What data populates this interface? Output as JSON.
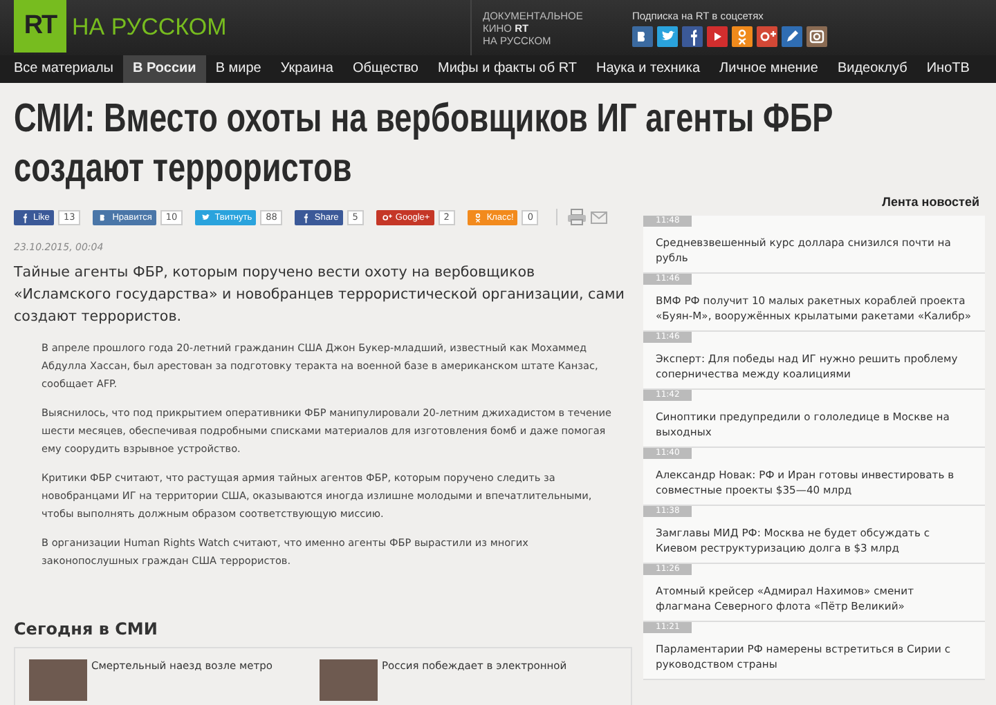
{
  "header": {
    "logo": "RT",
    "logo_caption": "НА РУССКОМ",
    "doc_lines": [
      "ДОКУМЕНТАЛЬНОЕ",
      "КИНО",
      "RT",
      "НА РУССКОМ"
    ],
    "social_title": "Подписка на RT в соцсетях",
    "social_icons": [
      {
        "kind": "vk",
        "color": "#3b6aa0"
      },
      {
        "kind": "twitter",
        "color": "#2aa3dd"
      },
      {
        "kind": "facebook",
        "color": "#3b5998"
      },
      {
        "kind": "youtube",
        "color": "#d22e2e"
      },
      {
        "kind": "odnoklassniki",
        "color": "#f08a1c"
      },
      {
        "kind": "googleplus",
        "color": "#d34836"
      },
      {
        "kind": "livejournal",
        "color": "#2f6db3"
      },
      {
        "kind": "instagram",
        "color": "#8a6b53"
      }
    ]
  },
  "nav": [
    {
      "label": "Все материалы",
      "selected": false
    },
    {
      "label": "В России",
      "selected": true
    },
    {
      "label": "В мире",
      "selected": false
    },
    {
      "label": "Украина",
      "selected": false
    },
    {
      "label": "Общество",
      "selected": false
    },
    {
      "label": "Мифы и факты об RT",
      "selected": false
    },
    {
      "label": "Наука и техника",
      "selected": false
    },
    {
      "label": "Личное мнение",
      "selected": false
    },
    {
      "label": "Видеоклуб",
      "selected": false
    },
    {
      "label": "ИноТВ",
      "selected": false
    }
  ],
  "article": {
    "title": "СМИ: Вместо охоты на вербовщиков ИГ агенты ФБР создают террористов",
    "share": [
      {
        "kind": "facebook",
        "label": "Like",
        "count": "13",
        "color": "#3b5998"
      },
      {
        "kind": "vk",
        "label": "Нравится",
        "count": "10",
        "color": "#4a76a8"
      },
      {
        "kind": "twitter",
        "label": "Твитнуть",
        "count": "88",
        "color": "#2aa3dd"
      },
      {
        "kind": "facebook",
        "label": "Share",
        "count": "5",
        "color": "#3b5998"
      },
      {
        "kind": "googleplus",
        "label": "Google+",
        "count": "2",
        "color": "#c53727"
      },
      {
        "kind": "odnoklassniki",
        "label": "Класс!",
        "count": "0",
        "color": "#f28a1d"
      }
    ],
    "date": "23.10.2015, 00:04",
    "lead": "Тайные агенты ФБР, которым поручено вести охоту на вербовщиков «Исламского государства» и новобранцев террористической организации, сами создают террористов.",
    "paragraphs": [
      "В апреле прошлого года 20-летний гражданин США Джон Букер-младший, известный как Мохаммед Абдулла Хассан, был арестован за подготовку теракта на военной базе в американском штате Канзас, сообщает AFP.",
      "Выяснилось, что под прикрытием оперативники ФБР манипулировали 20-летним джихадистом в течение шести месяцев, обеспечивая подробными списками материалов для изготовления бомб и даже помогая ему соорудить взрывное устройство.",
      "Критики ФБР считают, что растущая армия тайных агентов ФБР, которым поручено следить за новобранцами ИГ на территории США, оказываются иногда излишне молодыми и впечатлительными, чтобы выполнять должным образом соответствующую миссию.",
      "В организации Human Rights Watch считают, что именно агенты ФБР вырастили из многих законопослушных граждан США террористов."
    ]
  },
  "today": {
    "title": "Сегодня в СМИ",
    "items": [
      "Смертельный наезд возле метро",
      "Россия побеждает в электронной"
    ]
  },
  "news_feed": {
    "title": "Лента новостей",
    "items": [
      {
        "time": "11:48",
        "text": "Средневзвешенный курс доллара снизился почти на рубль"
      },
      {
        "time": "11:46",
        "text": "ВМФ РФ получит 10 малых ракетных кораблей проекта «Буян-М», вооружённых крылатыми ракетами «Калибр»"
      },
      {
        "time": "11:46",
        "text": "Эксперт: Для победы над ИГ нужно решить проблему соперничества между коалициями"
      },
      {
        "time": "11:42",
        "text": "Синоптики предупредили о гололедице в Москве на выходных"
      },
      {
        "time": "11:40",
        "text": "Александр Новак: РФ и Иран готовы инвестировать в совместные проекты $35—40 млрд"
      },
      {
        "time": "11:38",
        "text": "Замглавы МИД РФ: Москва не будет обсуждать с Киевом реструктуризацию долга в $3 млрд"
      },
      {
        "time": "11:26",
        "text": "Атомный крейсер «Адмирал Нахимов» сменит флагмана Северного флота «Пётр Великий»"
      },
      {
        "time": "11:21",
        "text": "Парламентарии РФ намерены встретиться в Сирии с руководством страны"
      }
    ]
  }
}
